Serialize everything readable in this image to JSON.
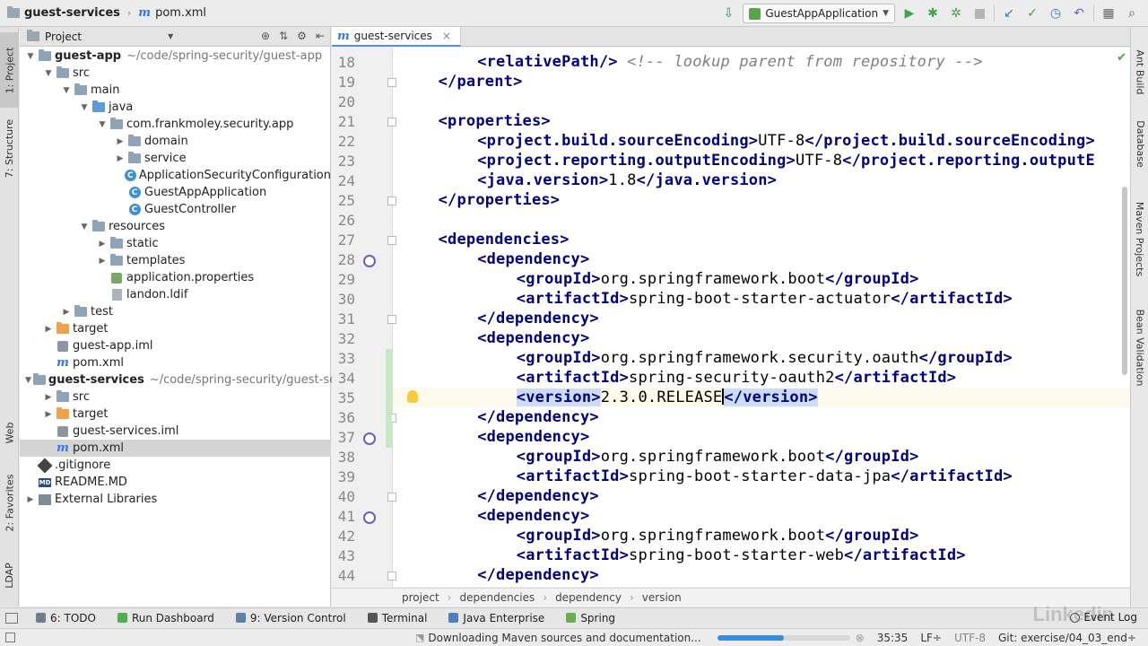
{
  "nav": {
    "project": "guest-services",
    "file": "pom.xml",
    "run_config": "GuestAppApplication"
  },
  "left_tabs": [
    "1: Project",
    "7: Structure",
    "Web",
    "2: Favorites",
    "LDAP"
  ],
  "right_tabs": [
    "Ant Build",
    "Database",
    "Maven Projects",
    "Bean Validation"
  ],
  "project_panel": {
    "title": "Project",
    "tree": [
      {
        "depth": 0,
        "arrow": "open",
        "icon": "module",
        "label": "guest-app",
        "bold": true,
        "path": "~/code/spring-security/guest-app"
      },
      {
        "depth": 1,
        "arrow": "open",
        "icon": "folder",
        "label": "src"
      },
      {
        "depth": 2,
        "arrow": "open",
        "icon": "folder",
        "label": "main"
      },
      {
        "depth": 3,
        "arrow": "open",
        "icon": "folder-blue",
        "label": "java"
      },
      {
        "depth": 4,
        "arrow": "open",
        "icon": "folder",
        "label": "com.frankmoley.security.app"
      },
      {
        "depth": 5,
        "arrow": "closed",
        "icon": "folder",
        "label": "domain"
      },
      {
        "depth": 5,
        "arrow": "closed",
        "icon": "folder",
        "label": "service"
      },
      {
        "depth": 5,
        "arrow": "none",
        "icon": "class",
        "label": "ApplicationSecurityConfiguration"
      },
      {
        "depth": 5,
        "arrow": "none",
        "icon": "class",
        "label": "GuestAppApplication"
      },
      {
        "depth": 5,
        "arrow": "none",
        "icon": "class",
        "label": "GuestController"
      },
      {
        "depth": 3,
        "arrow": "open",
        "icon": "folder",
        "label": "resources"
      },
      {
        "depth": 4,
        "arrow": "closed",
        "icon": "folder",
        "label": "static"
      },
      {
        "depth": 4,
        "arrow": "closed",
        "icon": "folder",
        "label": "templates"
      },
      {
        "depth": 4,
        "arrow": "none",
        "icon": "prop",
        "label": "application.properties"
      },
      {
        "depth": 4,
        "arrow": "none",
        "icon": "file",
        "label": "landon.ldif"
      },
      {
        "depth": 2,
        "arrow": "closed",
        "icon": "folder",
        "label": "test"
      },
      {
        "depth": 1,
        "arrow": "closed",
        "icon": "folder-orange",
        "label": "target"
      },
      {
        "depth": 1,
        "arrow": "none",
        "icon": "iml",
        "label": "guest-app.iml"
      },
      {
        "depth": 1,
        "arrow": "none",
        "icon": "maven",
        "label": "pom.xml"
      },
      {
        "depth": 0,
        "arrow": "open",
        "icon": "module",
        "label": "guest-services",
        "bold": true,
        "path": "~/code/spring-security/guest-ser"
      },
      {
        "depth": 1,
        "arrow": "closed",
        "icon": "folder",
        "label": "src"
      },
      {
        "depth": 1,
        "arrow": "closed",
        "icon": "folder-orange",
        "label": "target"
      },
      {
        "depth": 1,
        "arrow": "none",
        "icon": "iml",
        "label": "guest-services.iml"
      },
      {
        "depth": 1,
        "arrow": "none",
        "icon": "maven",
        "label": "pom.xml",
        "selected": true
      },
      {
        "depth": 0,
        "arrow": "none",
        "icon": "git",
        "label": ".gitignore"
      },
      {
        "depth": 0,
        "arrow": "none",
        "icon": "md",
        "label": "README.MD"
      },
      {
        "depth": 0,
        "arrow": "closed",
        "icon": "lib",
        "label": "External Libraries"
      }
    ]
  },
  "editor": {
    "tab_label": "guest-services",
    "current_line": 35,
    "lines": [
      {
        "n": 18,
        "indent": 2,
        "parts": [
          [
            "tag",
            "<relativePath/>"
          ],
          [
            "txt",
            " "
          ],
          [
            "cmt",
            "<!-- lookup parent from repository -->"
          ]
        ]
      },
      {
        "n": 19,
        "indent": 1,
        "parts": [
          [
            "tag",
            "</parent>"
          ]
        ]
      },
      {
        "n": 20,
        "indent": 0,
        "parts": []
      },
      {
        "n": 21,
        "indent": 1,
        "parts": [
          [
            "tag",
            "<properties>"
          ]
        ]
      },
      {
        "n": 22,
        "indent": 2,
        "parts": [
          [
            "tag",
            "<project.build.sourceEncoding>"
          ],
          [
            "txt",
            "UTF-8"
          ],
          [
            "tag",
            "</project.build.sourceEncoding>"
          ]
        ]
      },
      {
        "n": 23,
        "indent": 2,
        "parts": [
          [
            "tag",
            "<project.reporting.outputEncoding>"
          ],
          [
            "txt",
            "UTF-8"
          ],
          [
            "tag",
            "</project.reporting.outputE"
          ]
        ]
      },
      {
        "n": 24,
        "indent": 2,
        "parts": [
          [
            "tag",
            "<java.version>"
          ],
          [
            "txt",
            "1.8"
          ],
          [
            "tag",
            "</java.version>"
          ]
        ]
      },
      {
        "n": 25,
        "indent": 1,
        "parts": [
          [
            "tag",
            "</properties>"
          ]
        ]
      },
      {
        "n": 26,
        "indent": 0,
        "parts": []
      },
      {
        "n": 27,
        "indent": 1,
        "parts": [
          [
            "tag",
            "<dependencies>"
          ]
        ]
      },
      {
        "n": 28,
        "indent": 2,
        "parts": [
          [
            "tag",
            "<dependency>"
          ]
        ]
      },
      {
        "n": 29,
        "indent": 3,
        "parts": [
          [
            "tag",
            "<groupId>"
          ],
          [
            "txt",
            "org.springframework.boot"
          ],
          [
            "tag",
            "</groupId>"
          ]
        ]
      },
      {
        "n": 30,
        "indent": 3,
        "parts": [
          [
            "tag",
            "<artifactId>"
          ],
          [
            "txt",
            "spring-boot-starter-actuator"
          ],
          [
            "tag",
            "</artifactId>"
          ]
        ]
      },
      {
        "n": 31,
        "indent": 2,
        "parts": [
          [
            "tag",
            "</dependency>"
          ]
        ]
      },
      {
        "n": 32,
        "indent": 2,
        "parts": [
          [
            "tag",
            "<dependency>"
          ]
        ]
      },
      {
        "n": 33,
        "indent": 3,
        "parts": [
          [
            "tag",
            "<groupId>"
          ],
          [
            "txt",
            "org.springframework.security.oauth"
          ],
          [
            "tag",
            "</groupId>"
          ]
        ]
      },
      {
        "n": 34,
        "indent": 3,
        "parts": [
          [
            "tag",
            "<artifactId>"
          ],
          [
            "txt",
            "spring-security-oauth2"
          ],
          [
            "tag",
            "</artifactId>"
          ]
        ]
      },
      {
        "n": 35,
        "indent": 3,
        "parts": [
          [
            "taghl",
            "<version>"
          ],
          [
            "txt",
            "2.3.0.RELEASE"
          ],
          [
            "caret",
            ""
          ],
          [
            "taghl",
            "</version>"
          ]
        ]
      },
      {
        "n": 36,
        "indent": 2,
        "parts": [
          [
            "tag",
            "</dependency>"
          ]
        ]
      },
      {
        "n": 37,
        "indent": 2,
        "parts": [
          [
            "tag",
            "<dependency>"
          ]
        ]
      },
      {
        "n": 38,
        "indent": 3,
        "parts": [
          [
            "tag",
            "<groupId>"
          ],
          [
            "txt",
            "org.springframework.boot"
          ],
          [
            "tag",
            "</groupId>"
          ]
        ]
      },
      {
        "n": 39,
        "indent": 3,
        "parts": [
          [
            "tag",
            "<artifactId>"
          ],
          [
            "txt",
            "spring-boot-starter-data-jpa"
          ],
          [
            "tag",
            "</artifactId>"
          ]
        ]
      },
      {
        "n": 40,
        "indent": 2,
        "parts": [
          [
            "tag",
            "</dependency>"
          ]
        ]
      },
      {
        "n": 41,
        "indent": 2,
        "parts": [
          [
            "tag",
            "<dependency>"
          ]
        ]
      },
      {
        "n": 42,
        "indent": 3,
        "parts": [
          [
            "tag",
            "<groupId>"
          ],
          [
            "txt",
            "org.springframework.boot"
          ],
          [
            "tag",
            "</groupId>"
          ]
        ]
      },
      {
        "n": 43,
        "indent": 3,
        "parts": [
          [
            "tag",
            "<artifactId>"
          ],
          [
            "txt",
            "spring-boot-starter-web"
          ],
          [
            "tag",
            "</artifactId>"
          ]
        ]
      },
      {
        "n": 44,
        "indent": 2,
        "parts": [
          [
            "tag",
            "</dependency>"
          ]
        ]
      }
    ],
    "breadcrumb": [
      "project",
      "dependencies",
      "dependency",
      "version"
    ]
  },
  "bottom_tabs": [
    {
      "label": "6: TODO",
      "color": "#6d7e8f"
    },
    {
      "label": "Run Dashboard",
      "color": "#4caf50"
    },
    {
      "label": "9: Version Control",
      "color": "#5d7fa8"
    },
    {
      "label": "Terminal",
      "color": "#555555"
    },
    {
      "label": "Java Enterprise",
      "color": "#4f7fc0"
    },
    {
      "label": "Spring",
      "color": "#6ab04c"
    }
  ],
  "event_log": "Event Log",
  "status": {
    "message": "Downloading Maven sources and documentation...",
    "progress": 0.5,
    "position": "35:35",
    "line_sep": "LF÷",
    "encoding": "UTF-8",
    "git": "Git: exercise/04_03_end÷"
  },
  "watermark": "Linkedin",
  "colors": {
    "accent": "#3574f0",
    "tag": "#000080",
    "comment": "#808080",
    "selection": "#cddcf5"
  }
}
